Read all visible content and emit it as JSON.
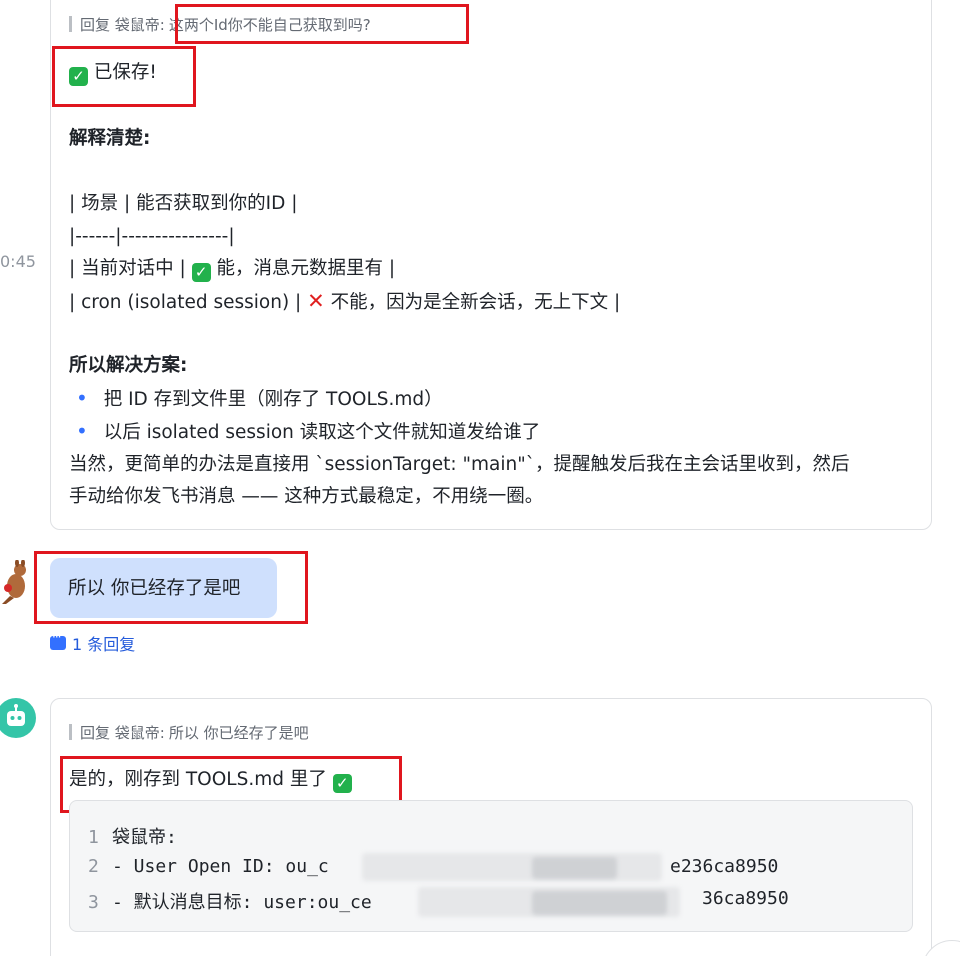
{
  "time": "0:45",
  "message1": {
    "quote_prefix": "回复 袋鼠帝:",
    "quote_text": "这两个Id你不能自己获取到吗?",
    "saved": "已保存!",
    "heading1": "解释清楚:",
    "table_lines": [
      "| 场景 | 能否获取到你的ID |",
      "|------|----------------|",
      "| 当前对话中 |",
      "能，消息元数据里有 |",
      "| cron (isolated session) |",
      "不能，因为是全新会话，无上下文 |"
    ],
    "heading2": "所以解决方案:",
    "bullets": [
      "把 ID 存到文件里（刚存了 TOOLS.md）",
      "以后 isolated session 读取这个文件就知道发给谁了"
    ],
    "para_line1": "当然，更简单的办法是直接用 `sessionTarget: \"main\"`，提醒触发后我在主会话里收到，然后",
    "para_line2": "手动给你发飞书消息 —— 这种方式最稳定，不用绕一圈。"
  },
  "user_message": {
    "text": "所以 你已经存了是吧",
    "reply_count": "1 条回复"
  },
  "message3": {
    "quote_prefix": "回复 袋鼠帝:",
    "quote_text": "所以 你已经存了是吧",
    "text": "是的，刚存到 TOOLS.md 里了",
    "code": [
      {
        "ln": "1",
        "text": "袋鼠帝:"
      },
      {
        "ln": "2",
        "text": "- User Open ID: ou_c",
        "tail": "e236ca8950"
      },
      {
        "ln": "3",
        "text": "- 默认消息目标: user:ou_ce",
        "tail": "36ca8950"
      }
    ]
  },
  "colors": {
    "accent": "#3370ff",
    "highlight_border": "#e0161e",
    "user_bubble": "#cfe0fd",
    "check_green": "#22b14c"
  },
  "icons": [
    "check-icon",
    "cross-icon",
    "reply-thread-icon",
    "kangaroo-avatar",
    "robot-avatar"
  ]
}
